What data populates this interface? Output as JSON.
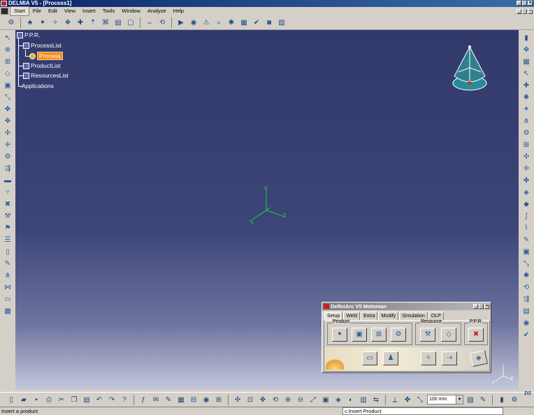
{
  "window": {
    "title": "DELMIA V5 - [Process1]"
  },
  "menu": {
    "items": [
      "Start",
      "File",
      "Edit",
      "View",
      "Insert",
      "Tools",
      "Window",
      "Analyze",
      "Help"
    ]
  },
  "tree": {
    "root": "P.P.R.",
    "process_list": "ProcessList",
    "process": "Process",
    "product_list": "ProductList",
    "resources_list": "ResourcesList",
    "applications": "Applications"
  },
  "axes": {
    "x": "x",
    "y": "y",
    "z": "z"
  },
  "dialog": {
    "title": "DelfoiArc V5 Motoman",
    "tabs": [
      "Setup",
      "Weld",
      "Extra",
      "Modify",
      "Simulation",
      "OLP"
    ],
    "groups": {
      "product": "Product",
      "resource": "Resource",
      "ppr": "P.P.R."
    }
  },
  "bottom_toolbar": {
    "zoom_value": "100 mm"
  },
  "status": {
    "message": "Insert a product",
    "command_input": "c:Insert Product"
  },
  "colors": {
    "viewport_top": "#323a6c",
    "viewport_bottom": "#c5c8db",
    "selection": "#f08a1c",
    "axis": "#22cc44"
  }
}
